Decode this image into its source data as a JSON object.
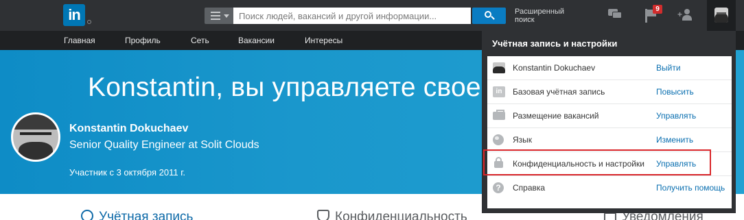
{
  "topbar": {
    "logo_text": "in",
    "search": {
      "category_icon": "menu-icon",
      "placeholder": "Поиск людей, вакансий и другой информации...",
      "button_icon": "search-icon"
    },
    "advanced_search_label": "Расширенный поиск",
    "notifications_badge": "9",
    "icons": [
      "messages-icon",
      "notifications-flag-icon",
      "add-connections-icon",
      "profile-avatar-icon"
    ]
  },
  "nav": {
    "items": [
      {
        "label": "Главная"
      },
      {
        "label": "Профиль"
      },
      {
        "label": "Сеть"
      },
      {
        "label": "Вакансии"
      },
      {
        "label": "Интересы"
      }
    ]
  },
  "hero": {
    "title": "Konstantin, вы управляете своей",
    "name": "Konstantin Dokuchaev",
    "headline": "Senior Quality Engineer at Solit Clouds",
    "member_since": "Участник с 3 октября 2011 г."
  },
  "bottom_tabs": [
    {
      "label": "Учётная запись",
      "icon": "account-icon"
    },
    {
      "label": "Конфиденциальность",
      "icon": "shield-icon"
    },
    {
      "label": "Уведомления",
      "icon": "envelope-icon"
    }
  ],
  "dropdown": {
    "header": "Учётная запись и настройки",
    "rows": [
      {
        "label": "Konstantin Dokuchaev",
        "action": "Выйти",
        "icon": "avatar-icon"
      },
      {
        "label": "Базовая учётная запись",
        "action": "Повысить",
        "icon": "linkedin-icon"
      },
      {
        "label": "Размещение вакансий",
        "action": "Управлять",
        "icon": "briefcase-icon"
      },
      {
        "label": "Язык",
        "action": "Изменить",
        "icon": "globe-icon"
      },
      {
        "label": "Конфиденциальность и настройки",
        "action": "Управлять",
        "icon": "lock-icon"
      },
      {
        "label": "Справка",
        "action": "Получить помощь",
        "icon": "help-icon"
      }
    ]
  },
  "colors": {
    "topbar": "#2f3134",
    "navbar": "#1f2123",
    "hero_blue": "#1a97cc",
    "link_blue": "#0a6fb0",
    "highlight_red": "#d9262a",
    "badge_red": "#d12d2d"
  }
}
